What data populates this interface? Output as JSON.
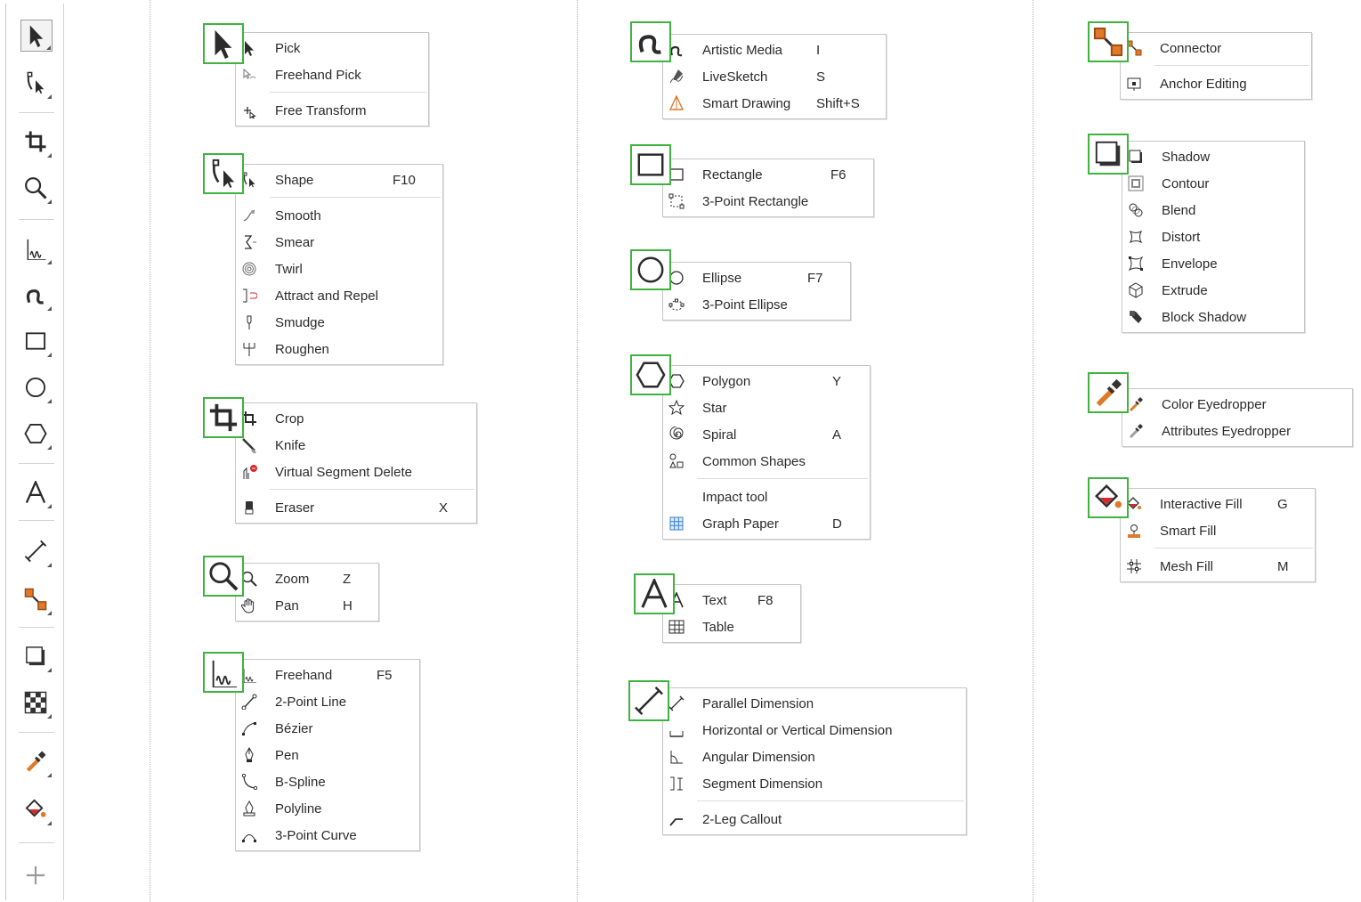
{
  "toolbox": {
    "tools": [
      {
        "name": "pick-tool-icon"
      },
      {
        "name": "shape-tool-icon"
      },
      {
        "name": "crop-tool-icon"
      },
      {
        "name": "zoom-tool-icon"
      },
      {
        "name": "freehand-tool-icon"
      },
      {
        "name": "artistic-media-tool-icon"
      },
      {
        "name": "rectangle-tool-icon"
      },
      {
        "name": "ellipse-tool-icon"
      },
      {
        "name": "polygon-tool-icon"
      },
      {
        "name": "text-tool-icon"
      },
      {
        "name": "parallel-dimension-tool-icon"
      },
      {
        "name": "connector-tool-icon"
      },
      {
        "name": "shadow-tool-icon"
      },
      {
        "name": "transparency-tool-icon"
      },
      {
        "name": "eyedropper-tool-icon"
      },
      {
        "name": "interactive-fill-tool-icon"
      },
      {
        "name": "add-tool-icon"
      }
    ]
  },
  "flyouts": {
    "pick": {
      "items": [
        {
          "label": "Pick",
          "shortcut": "",
          "icon": "pick-icon"
        },
        {
          "label": "Freehand Pick",
          "shortcut": "",
          "icon": "freehand-pick-icon"
        },
        {
          "label": "Free Transform",
          "shortcut": "",
          "icon": "free-transform-icon"
        }
      ]
    },
    "shape": {
      "items": [
        {
          "label": "Shape",
          "shortcut": "F10",
          "icon": "shape-icon"
        },
        {
          "label": "Smooth",
          "shortcut": "",
          "icon": "smooth-icon"
        },
        {
          "label": "Smear",
          "shortcut": "",
          "icon": "smear-icon"
        },
        {
          "label": "Twirl",
          "shortcut": "",
          "icon": "twirl-icon"
        },
        {
          "label": "Attract and Repel",
          "shortcut": "",
          "icon": "attract-repel-icon"
        },
        {
          "label": "Smudge",
          "shortcut": "",
          "icon": "smudge-icon"
        },
        {
          "label": "Roughen",
          "shortcut": "",
          "icon": "roughen-icon"
        }
      ]
    },
    "crop": {
      "items": [
        {
          "label": "Crop",
          "shortcut": "",
          "icon": "crop-icon"
        },
        {
          "label": "Knife",
          "shortcut": "",
          "icon": "knife-icon"
        },
        {
          "label": "Virtual Segment Delete",
          "shortcut": "",
          "icon": "virtual-segment-delete-icon"
        },
        {
          "label": "Eraser",
          "shortcut": "X",
          "icon": "eraser-icon"
        }
      ]
    },
    "zoom": {
      "items": [
        {
          "label": "Zoom",
          "shortcut": "Z",
          "icon": "zoom-icon"
        },
        {
          "label": "Pan",
          "shortcut": "H",
          "icon": "pan-icon"
        }
      ]
    },
    "freehand": {
      "items": [
        {
          "label": "Freehand",
          "shortcut": "F5",
          "icon": "freehand-icon"
        },
        {
          "label": "2-Point Line",
          "shortcut": "",
          "icon": "two-point-line-icon"
        },
        {
          "label": "Bézier",
          "shortcut": "",
          "icon": "bezier-icon"
        },
        {
          "label": "Pen",
          "shortcut": "",
          "icon": "pen-icon"
        },
        {
          "label": "B-Spline",
          "shortcut": "",
          "icon": "b-spline-icon"
        },
        {
          "label": "Polyline",
          "shortcut": "",
          "icon": "polyline-icon"
        },
        {
          "label": "3-Point Curve",
          "shortcut": "",
          "icon": "three-point-curve-icon"
        }
      ]
    },
    "artistic": {
      "items": [
        {
          "label": "Artistic Media",
          "shortcut": "I",
          "icon": "artistic-media-icon"
        },
        {
          "label": "LiveSketch",
          "shortcut": "S",
          "icon": "livesketch-icon"
        },
        {
          "label": "Smart Drawing",
          "shortcut": "Shift+S",
          "icon": "smart-drawing-icon"
        }
      ]
    },
    "rectangle": {
      "items": [
        {
          "label": "Rectangle",
          "shortcut": "F6",
          "icon": "rectangle-icon"
        },
        {
          "label": "3-Point Rectangle",
          "shortcut": "",
          "icon": "three-point-rectangle-icon"
        }
      ]
    },
    "ellipse": {
      "items": [
        {
          "label": "Ellipse",
          "shortcut": "F7",
          "icon": "ellipse-icon"
        },
        {
          "label": "3-Point Ellipse",
          "shortcut": "",
          "icon": "three-point-ellipse-icon"
        }
      ]
    },
    "polygon": {
      "items": [
        {
          "label": "Polygon",
          "shortcut": "Y",
          "icon": "polygon-icon"
        },
        {
          "label": "Star",
          "shortcut": "",
          "icon": "star-icon"
        },
        {
          "label": "Spiral",
          "shortcut": "A",
          "icon": "spiral-icon"
        },
        {
          "label": "Common Shapes",
          "shortcut": "",
          "icon": "common-shapes-icon"
        },
        {
          "label": "Impact tool",
          "shortcut": "",
          "icon": "impact-tool-icon"
        },
        {
          "label": "Graph Paper",
          "shortcut": "D",
          "icon": "graph-paper-icon"
        }
      ]
    },
    "text": {
      "items": [
        {
          "label": "Text",
          "shortcut": "F8",
          "icon": "text-icon"
        },
        {
          "label": "Table",
          "shortcut": "",
          "icon": "table-icon"
        }
      ]
    },
    "dimension": {
      "items": [
        {
          "label": "Parallel Dimension",
          "shortcut": "",
          "icon": "parallel-dimension-icon"
        },
        {
          "label": "Horizontal or Vertical Dimension",
          "shortcut": "",
          "icon": "horizontal-vertical-dimension-icon"
        },
        {
          "label": "Angular Dimension",
          "shortcut": "",
          "icon": "angular-dimension-icon"
        },
        {
          "label": "Segment Dimension",
          "shortcut": "",
          "icon": "segment-dimension-icon"
        },
        {
          "label": "2-Leg Callout",
          "shortcut": "",
          "icon": "two-leg-callout-icon"
        }
      ]
    },
    "connector": {
      "items": [
        {
          "label": "Connector",
          "shortcut": "",
          "icon": "connector-icon"
        },
        {
          "label": "Anchor Editing",
          "shortcut": "",
          "icon": "anchor-editing-icon"
        }
      ]
    },
    "effects": {
      "items": [
        {
          "label": "Shadow",
          "shortcut": "",
          "icon": "shadow-icon"
        },
        {
          "label": "Contour",
          "shortcut": "",
          "icon": "contour-icon"
        },
        {
          "label": "Blend",
          "shortcut": "",
          "icon": "blend-icon"
        },
        {
          "label": "Distort",
          "shortcut": "",
          "icon": "distort-icon"
        },
        {
          "label": "Envelope",
          "shortcut": "",
          "icon": "envelope-icon"
        },
        {
          "label": "Extrude",
          "shortcut": "",
          "icon": "extrude-icon"
        },
        {
          "label": "Block Shadow",
          "shortcut": "",
          "icon": "block-shadow-icon"
        }
      ]
    },
    "eyedropper": {
      "items": [
        {
          "label": "Color Eyedropper",
          "shortcut": "",
          "icon": "color-eyedropper-icon"
        },
        {
          "label": "Attributes Eyedropper",
          "shortcut": "",
          "icon": "attributes-eyedropper-icon"
        }
      ]
    },
    "fill": {
      "items": [
        {
          "label": "Interactive Fill",
          "shortcut": "G",
          "icon": "interactive-fill-icon"
        },
        {
          "label": "Smart Fill",
          "shortcut": "",
          "icon": "smart-fill-icon"
        },
        {
          "label": "Mesh Fill",
          "shortcut": "M",
          "icon": "mesh-fill-icon"
        }
      ]
    }
  },
  "colors": {
    "highlight": "#3fb33f",
    "accent_red": "#d42a2a",
    "accent_orange": "#e07a2a"
  }
}
